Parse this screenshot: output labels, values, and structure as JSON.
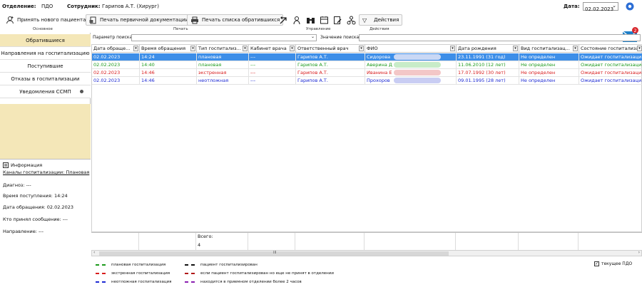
{
  "top": {
    "department_label": "Отделение:",
    "department_value": "ПДО",
    "employee_label": "Сотрудник:",
    "employee_value": "Гарипов А.Т. (Хирург)",
    "date_label": "Дата:",
    "date_value": "02.02.2023"
  },
  "toolbar": {
    "accept_patient": "Принять нового пациента",
    "print_primary": "Печать первичной документации",
    "print_list": "Печать списка обратившихся",
    "actions": "Действия",
    "groups": {
      "main": "Основное",
      "print": "Печать",
      "manage": "Управление",
      "actions": "Действия"
    },
    "mail_badge": "2"
  },
  "sidebar": {
    "items": [
      {
        "label": "Обратившиеся"
      },
      {
        "label": "Направления на госпитализацию"
      },
      {
        "label": "Поступившие"
      },
      {
        "label": "Отказы в госпитализации"
      },
      {
        "label": "Уведомления ССМП"
      }
    ],
    "info": {
      "title": "Информация",
      "channels": "Каналы госпитализации: Плановая",
      "diagnosis": "Диагноз: ---",
      "arrival_time": "Время поступления: 14:24",
      "visit_date": "Дата обращения: 02.02.2023",
      "accepted_by": "Кто принял сообщение: ---",
      "direction": "Направление: ---"
    }
  },
  "search": {
    "param_label": "Параметр поиска",
    "value_label": "Значение поиска"
  },
  "table": {
    "headers": [
      "Дата обраще...",
      "Время обращения",
      "Тип госпитализ...",
      "Кабинет врача",
      "Ответственный врач",
      "ФИО",
      "Дата рождения",
      "Вид госпитализац...",
      "Состояние госпитализаци"
    ],
    "rows": [
      [
        "02.02.2023",
        "14:24",
        "плановая",
        "---",
        "Гарипов А.Т.",
        "Сидорова",
        "23.11.1991 (31 год)",
        "Не определен",
        "Ожидает госпитализаци"
      ],
      [
        "02.02.2023",
        "14:40",
        "плановая",
        "---",
        "Гарипов А.Т.",
        "Аверина Д",
        "11.06.2010 (12 лет)",
        "Не определен",
        "Ожидает госпитализаци"
      ],
      [
        "02.02.2023",
        "14:46",
        "экстренная",
        "---",
        "Гарипов А.Т.",
        "Иванина Е",
        "17.07.1992 (30 лет)",
        "Не определен",
        "Ожидает госпитализаци"
      ],
      [
        "02.02.2023",
        "14:46",
        "неотложная",
        "---",
        "Гарипов А.Т.",
        "Прохоров",
        "09.01.1995 (28 лет)",
        "Не определен",
        "Ожидает госпитализаци"
      ]
    ],
    "row_colors": [
      "#1c9a1c",
      "#1c9a1c",
      "#d81d1d",
      "#1e2bd4"
    ],
    "total_label": "Всего:",
    "total_value": "4",
    "scroll_label": "III"
  },
  "legend": {
    "items": [
      {
        "label": "плановая госпитализация",
        "color": "#1c9a1c"
      },
      {
        "label": "экстренная госпитализация",
        "color": "#d81d1d"
      },
      {
        "label": "неотложная госпитализация",
        "color": "#1e2bd4"
      },
      {
        "label": "пациент госпитализирован",
        "color": "#111111"
      },
      {
        "label": "если пациент госпитализирован но еще не принят в отделении",
        "color": "#b01818"
      },
      {
        "label": "находится в приемном отделении более 2 часов",
        "color": "#8a1fb0"
      }
    ],
    "checkbox_label": "текущее ПДО"
  }
}
